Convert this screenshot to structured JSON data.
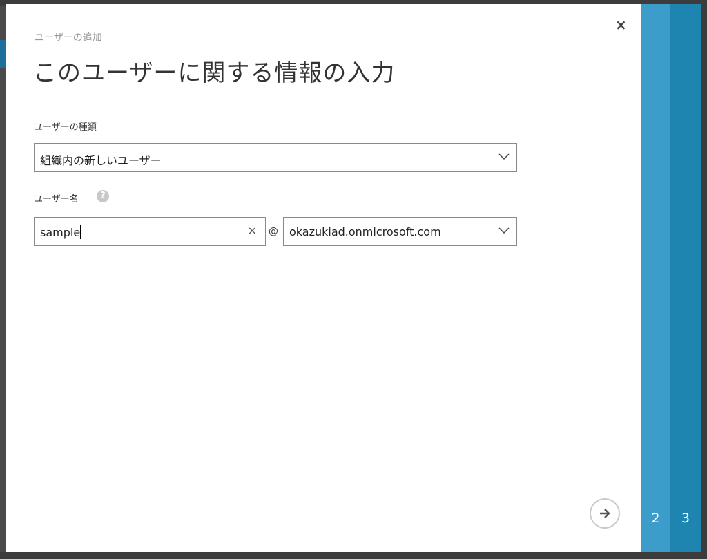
{
  "dialog": {
    "subtitle": "ユーザーの追加",
    "title": "このユーザーに関する情報の入力",
    "close_label": "×"
  },
  "user_type": {
    "label": "ユーザーの種類",
    "value": "組織内の新しいユーザー"
  },
  "user_name": {
    "label": "ユーザー名",
    "help_label": "?",
    "value": "sample",
    "clear_label": "×",
    "at_sign": "@",
    "domain_value": "okazukiad.onmicrosoft.com"
  },
  "steps": [
    {
      "label": "2",
      "color": "#3c9dca"
    },
    {
      "label": "3",
      "color": "#1e84b0"
    }
  ],
  "next_icon": "arrow-right-icon"
}
